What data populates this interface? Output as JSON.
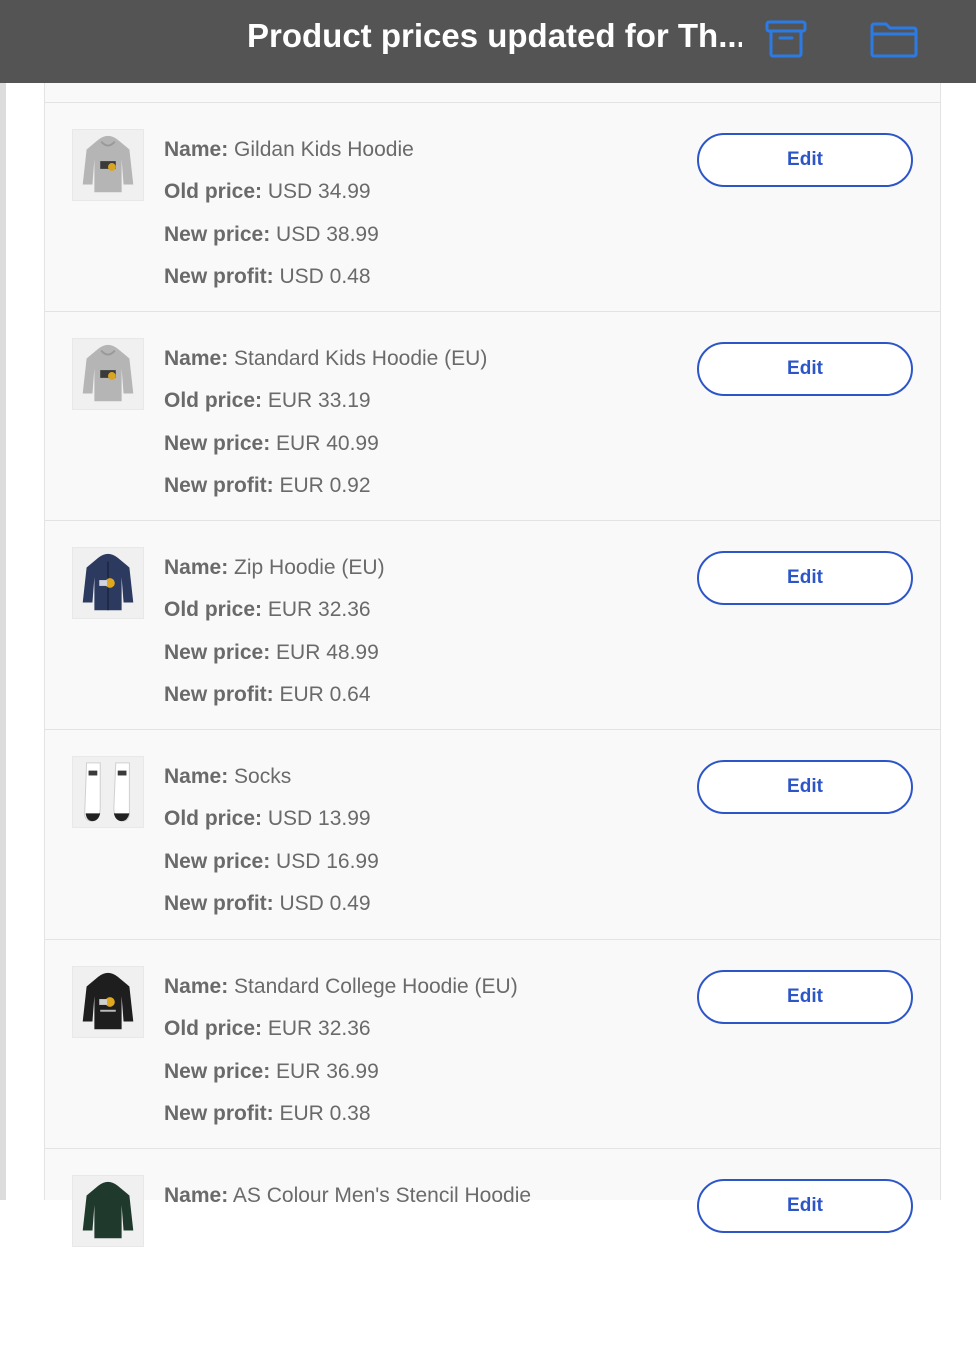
{
  "header": {
    "title": "Product prices updated for Th...",
    "archive_icon": "archive-box-icon",
    "folder_icon": "folder-icon",
    "accent": "#2c7be5"
  },
  "labels": {
    "name": "Name:",
    "old_price": "Old price:",
    "new_price": "New price:",
    "new_profit": "New profit:"
  },
  "products": [
    {
      "name": "Gildan Kids Hoodie",
      "old_price": "USD 34.99",
      "new_price": "USD 38.99",
      "new_profit": "USD 0.48",
      "edit_label": "Edit",
      "thumb": "gray-hoodie"
    },
    {
      "name": "Standard Kids Hoodie (EU)",
      "old_price": "EUR 33.19",
      "new_price": "EUR 40.99",
      "new_profit": "EUR 0.92",
      "edit_label": "Edit",
      "thumb": "gray-hoodie"
    },
    {
      "name": "Zip Hoodie (EU)",
      "old_price": "EUR 32.36",
      "new_price": "EUR 48.99",
      "new_profit": "EUR 0.64",
      "edit_label": "Edit",
      "thumb": "navy-zip-hoodie"
    },
    {
      "name": "Socks",
      "old_price": "USD 13.99",
      "new_price": "USD 16.99",
      "new_profit": "USD 0.49",
      "edit_label": "Edit",
      "thumb": "white-socks"
    },
    {
      "name": "Standard College Hoodie (EU)",
      "old_price": "EUR 32.36",
      "new_price": "EUR 36.99",
      "new_profit": "EUR 0.38",
      "edit_label": "Edit",
      "thumb": "black-hoodie"
    },
    {
      "name": "AS Colour Men's Stencil Hoodie",
      "old_price": "",
      "new_price": "",
      "new_profit": "",
      "edit_label": "Edit",
      "thumb": "green-hoodie"
    }
  ],
  "colors": {
    "header_bg": "#545454",
    "button_blue": "#2c55c8",
    "text_gray": "#6a6a6a"
  }
}
